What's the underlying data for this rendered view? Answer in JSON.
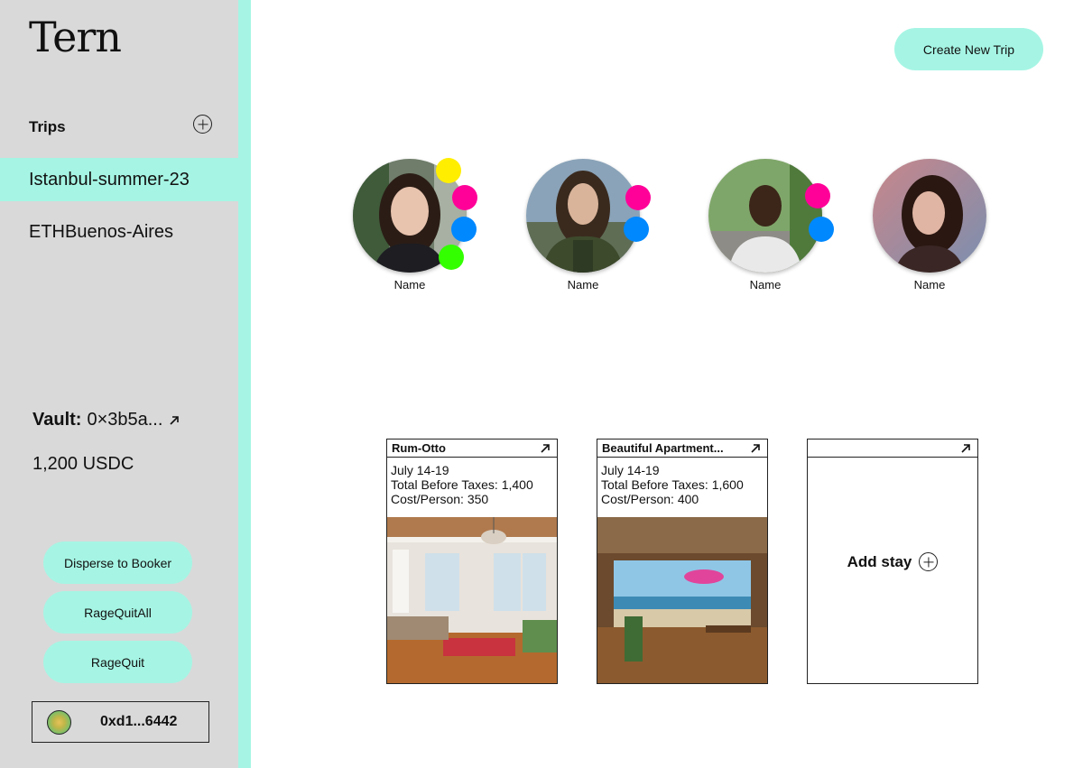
{
  "app": {
    "logo": "Tern"
  },
  "sidebar": {
    "trips_label": "Trips",
    "trips": [
      {
        "label": "Istanbul-summer-23",
        "active": true
      },
      {
        "label": "ETHBuenos-Aires",
        "active": false
      }
    ],
    "vault_label": "Vault:",
    "vault_address": "0×3b5a...",
    "balance": "1,200 USDC",
    "buttons": {
      "disperse": "Disperse to Booker",
      "ragequit_all": "RageQuitAll",
      "ragequit": "RageQuit"
    },
    "wallet_address": "0xd1...6442"
  },
  "header": {
    "create_trip": "Create New Trip"
  },
  "members": [
    {
      "name": "Name",
      "dots": [
        "#ffee00",
        "#ff0099",
        "#0088ff",
        "#33ff00"
      ]
    },
    {
      "name": "Name",
      "dots": [
        "#ff0099",
        "#0088ff"
      ]
    },
    {
      "name": "Name",
      "dots": [
        "#ff0099",
        "#0088ff"
      ]
    },
    {
      "name": "Name",
      "dots": []
    }
  ],
  "stays": [
    {
      "title": "Rum-Otto",
      "dates": "July 14-19",
      "total": "Total Before Taxes: 1,400",
      "cost": "Cost/Person: 350"
    },
    {
      "title": "Beautiful Apartment...",
      "dates": "July 14-19",
      "total": "Total Before Taxes: 1,600",
      "cost": "Cost/Person: 400"
    }
  ],
  "add_stay_label": "Add stay",
  "colors": {
    "accent": "#a6f5e4",
    "sidebar": "#d9d9d9"
  }
}
